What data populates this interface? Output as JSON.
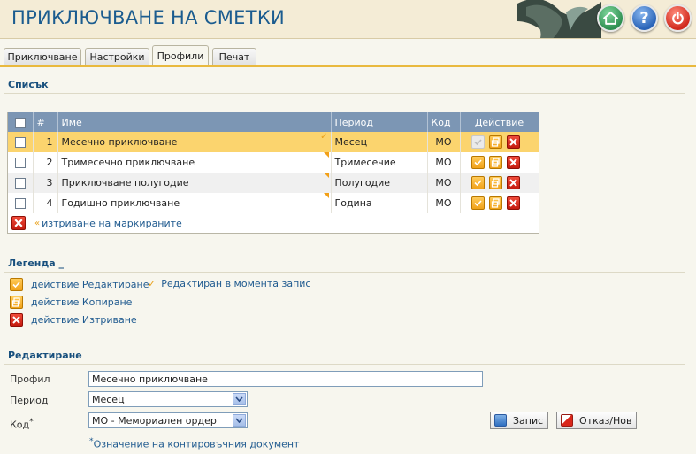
{
  "app": {
    "title": "ПРИКЛЮЧВАНЕ НА СМЕТКИ"
  },
  "header_buttons": [
    {
      "icon": "home-icon"
    },
    {
      "icon": "help-icon",
      "glyph": "?"
    },
    {
      "icon": "power-icon"
    }
  ],
  "tabs": [
    "Приключване",
    "Настройки",
    "Профили",
    "Печат"
  ],
  "active_tab": "Профили",
  "list": {
    "section_title": "Списък",
    "columns": [
      "#",
      "Име",
      "Период",
      "Код",
      "Действие"
    ],
    "rows": [
      {
        "num": "1",
        "name": "Месечно приключване",
        "period": "Месец",
        "code": "МО",
        "selected": true
      },
      {
        "num": "2",
        "name": "Тримесечно приключване",
        "period": "Тримесечие",
        "code": "МО"
      },
      {
        "num": "3",
        "name": "Приключване полугодие",
        "period": "Полугодие",
        "code": "МО"
      },
      {
        "num": "4",
        "name": "Годишно приключване",
        "period": "Година",
        "code": "МО"
      }
    ],
    "delete_marked": "изтриване на маркираните"
  },
  "legend": {
    "section_title": "Легенда _",
    "edit": "действие Редактиране",
    "copy": "действие Копиране",
    "delete": "действие Изтриване",
    "edited_now": "Редактиран в момента запис"
  },
  "edit": {
    "section_title": "Редактиране",
    "profile_label": "Профил",
    "profile_value": "Месечно приключване",
    "period_label": "Период",
    "period_value": "Месец",
    "code_label": "Код",
    "code_required": "*",
    "code_value": "МО - Мемориален ордер",
    "save_label": "Запис",
    "cancel_label": "Отказ/Нов",
    "note_star": "*",
    "note": "Означение на контировъчния документ"
  },
  "colors": {
    "accent": "#e9b93e",
    "title": "#1b5c8f",
    "header_bg": "#7c96b4",
    "selected_row": "#fbd46e"
  }
}
